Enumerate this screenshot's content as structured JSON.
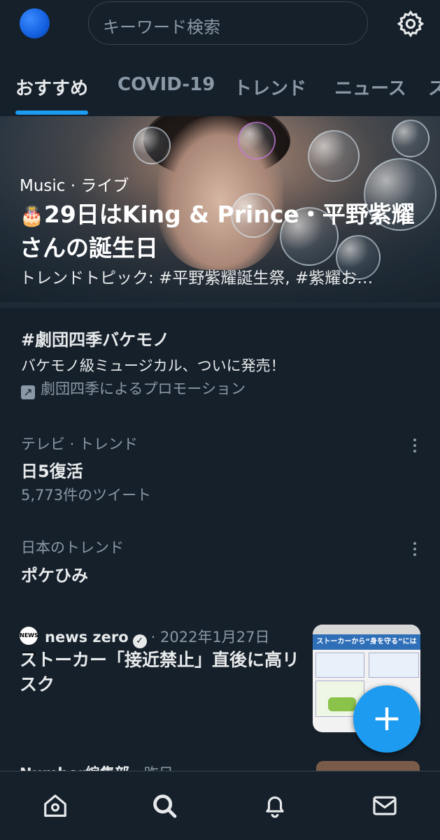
{
  "search": {
    "placeholder": "キーワード検索"
  },
  "tabs": [
    {
      "label": "おすすめ",
      "active": true
    },
    {
      "label": "COVID-19"
    },
    {
      "label": "トレンド"
    },
    {
      "label": "ニュース"
    },
    {
      "label": "ス"
    }
  ],
  "hero": {
    "category": "Music · ライブ",
    "title": "29日はKing & Prince・平野紫耀さんの誕生日",
    "subtitle": "トレンドトピック: #平野紫耀誕生祭, #紫耀お…",
    "emoji": "🎂"
  },
  "promoted": {
    "title": "#劇団四季バケモノ",
    "text": "バケモノ級ミュージカル、ついに発売！",
    "promo_label": "劇団四季によるプロモーション"
  },
  "trends": [
    {
      "context": "テレビ · トレンド",
      "name": "日5復活",
      "count": "5,773件のツイート"
    },
    {
      "context": "日本のトレンド",
      "name": "ポケひみ"
    }
  ],
  "news": {
    "logo_text": "NEWS zero",
    "source": "news zero",
    "date": "· 2022年1月27日",
    "headline": "ストーカー「接近禁止」直後に高リスク",
    "thumb_head": "ストーカーから“身を守る”には"
  },
  "next_item": {
    "source": "Number編集部",
    "date": "· 昨日"
  },
  "fab": {
    "label": "+"
  },
  "colors": {
    "accent": "#1d9bf0",
    "background": "#15202b",
    "muted": "#8b98a5"
  }
}
